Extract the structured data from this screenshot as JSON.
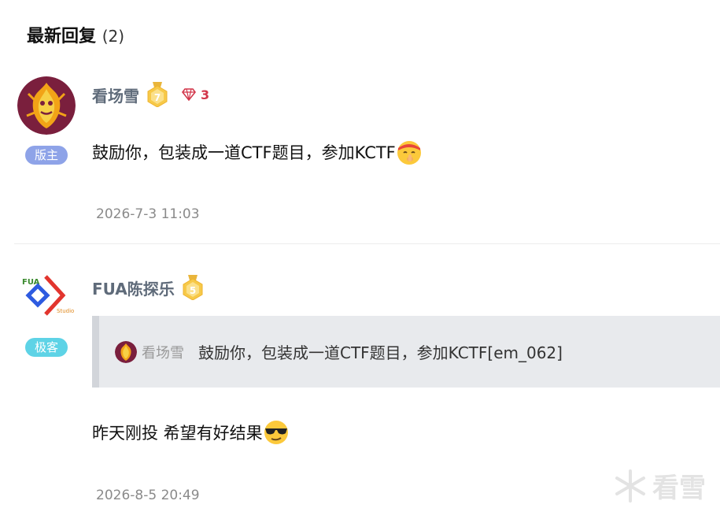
{
  "header": {
    "title": "最新回复",
    "count": "(2)"
  },
  "replies": [
    {
      "username": "看场雪",
      "level": "7",
      "gem_count": "3",
      "role": "版主",
      "content": "鼓励你，包装成一道CTF题目，参加KCTF",
      "emoji": "shushing-face-emoji",
      "timestamp": "2026-7-3 11:03"
    },
    {
      "username": "FUA陈探乐",
      "level": "5",
      "role": "极客",
      "avatar_text": {
        "top": "FUA",
        "bottom": "Studio"
      },
      "quote": {
        "username": "看场雪",
        "text": "鼓励你，包装成一道CTF题目，参加KCTF[em_062]"
      },
      "content": "昨天刚投 希望有好结果",
      "emoji": "cool-sunglasses-emoji",
      "timestamp": "2026-8-5 20:49"
    }
  ],
  "watermark": {
    "text": "看雪"
  },
  "colors": {
    "admin_badge": "#8ea3e8",
    "geek_badge": "#5ed3e6",
    "gem": "#d2364a",
    "username": "#5f6b7a",
    "quote_bg": "#e8eaed"
  }
}
